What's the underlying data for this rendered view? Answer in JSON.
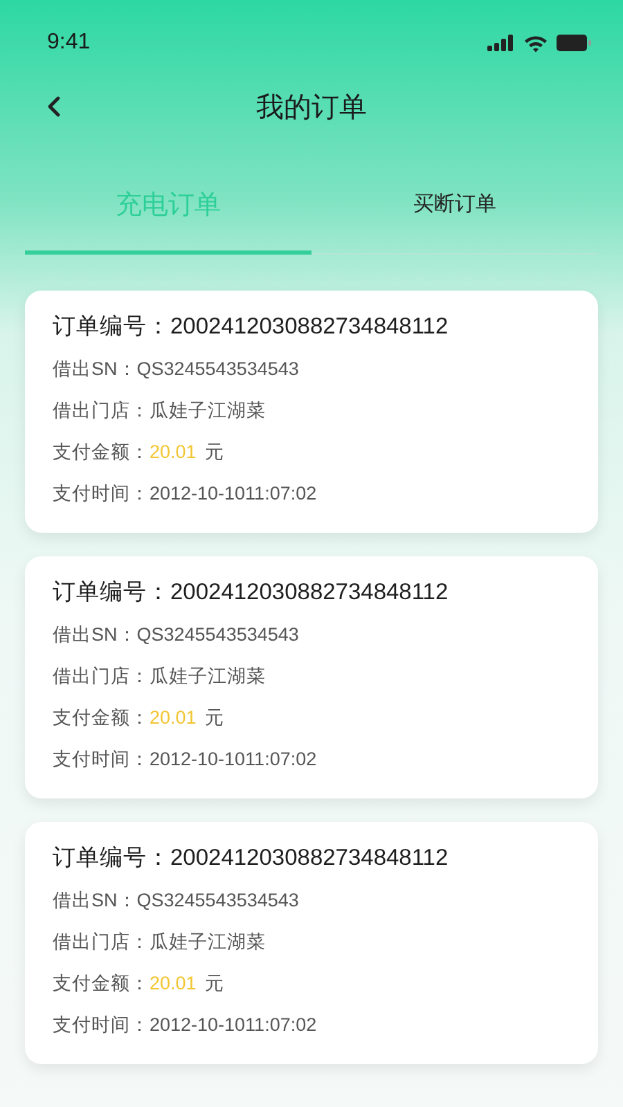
{
  "status_bar": {
    "time": "9:41"
  },
  "header": {
    "title": "我的订单"
  },
  "tabs": [
    {
      "label": "充电订单",
      "selected": true
    },
    {
      "label": "买断订单",
      "selected": false
    }
  ],
  "orders": [
    {
      "title": "订单编号：2002412030882734848112",
      "rows": [
        {
          "kind": "text",
          "label": "借出SN：",
          "value": "QS3245543534543"
        },
        {
          "kind": "text",
          "label": "借出门店：",
          "value": "瓜娃子江湖菜"
        },
        {
          "kind": "amount",
          "label": "支付金额：",
          "value": "20.01",
          "unit": "元"
        },
        {
          "kind": "text",
          "label": "支付时间：",
          "value": "2012-10-1011:07:02"
        }
      ]
    },
    {
      "title": "订单编号：2002412030882734848112",
      "rows": [
        {
          "kind": "text",
          "label": "借出SN：",
          "value": "QS3245543534543"
        },
        {
          "kind": "text",
          "label": "借出门店：",
          "value": "瓜娃子江湖菜"
        },
        {
          "kind": "amount",
          "label": "支付金额：",
          "value": "20.01",
          "unit": "元"
        },
        {
          "kind": "text",
          "label": "支付时间：",
          "value": "2012-10-1011:07:02"
        }
      ]
    },
    {
      "title": "订单编号：2002412030882734848112",
      "rows": [
        {
          "kind": "text",
          "label": "借出SN：",
          "value": "QS3245543534543"
        },
        {
          "kind": "text",
          "label": "借出门店：",
          "value": "瓜娃子江湖菜"
        },
        {
          "kind": "amount",
          "label": "支付金额：",
          "value": "20.01",
          "unit": "元"
        },
        {
          "kind": "text",
          "label": "支付时间：",
          "value": "2012-10-1011:07:02"
        }
      ]
    }
  ]
}
